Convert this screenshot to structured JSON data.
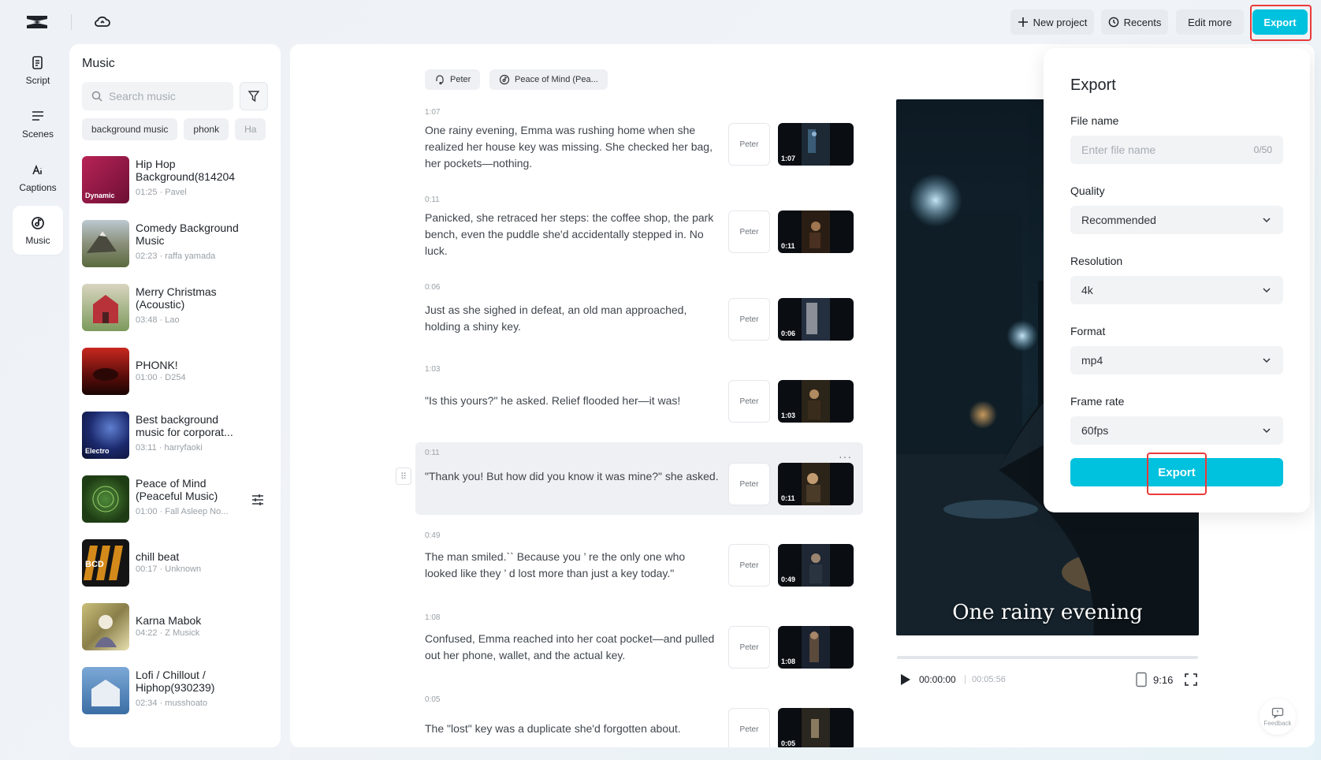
{
  "header": {
    "logo_icon": "capcut-logo-icon",
    "cloud_icon": "cloud-icon",
    "new_project_label": "New project",
    "recents_label": "Recents",
    "edit_more_label": "Edit more",
    "export_label": "Export"
  },
  "nav": [
    {
      "label": "Script",
      "icon": "script-icon"
    },
    {
      "label": "Scenes",
      "icon": "scenes-icon"
    },
    {
      "label": "Captions",
      "icon": "captions-icon"
    },
    {
      "label": "Music",
      "icon": "music-icon",
      "active": true
    }
  ],
  "music": {
    "title": "Music",
    "search_placeholder": "Search music",
    "chips": [
      "background music",
      "phonk",
      "Ha"
    ],
    "tracks": [
      {
        "title": "Hip Hop Background(814204",
        "meta": "01:25 · Pavel",
        "thumb_label": "Dynamic"
      },
      {
        "title": "Comedy Background Music",
        "meta": "02:23 · raffa yamada",
        "thumb_label": ""
      },
      {
        "title": "Merry Christmas (Acoustic)",
        "meta": "03:48 · Lao",
        "thumb_label": ""
      },
      {
        "title": "PHONK!",
        "meta": "01:00 · D254",
        "thumb_label": ""
      },
      {
        "title": "Best background music for corporat...",
        "meta": "03:11 · harryfaoki",
        "thumb_label": "Electro"
      },
      {
        "title": "Peace of Mind (Peaceful Music)",
        "meta": "01:00 · Fall Asleep No...",
        "thumb_label": ""
      },
      {
        "title": "chill beat",
        "meta": "00:17 · Unknown",
        "thumb_label": "BCD"
      },
      {
        "title": "Karna Mabok",
        "meta": "04:22 · Z Musick",
        "thumb_label": ""
      },
      {
        "title": "Lofi / Chillout / Hiphop(930239)",
        "meta": "02:34 · musshoato",
        "thumb_label": ""
      }
    ]
  },
  "script": {
    "tags": [
      {
        "label": "Peter",
        "icon": "voice-icon"
      },
      {
        "label": "Peace of Mind (Pea...",
        "icon": "music-note-icon"
      }
    ],
    "rows": [
      {
        "time": "1:07",
        "text": "One rainy evening, Emma was rushing home when she realized her house key was missing. She checked her bag, her pockets—nothing.",
        "voice": "Peter",
        "clip": "1:07"
      },
      {
        "time": "0:11",
        "text": "Panicked, she retraced her steps: the coffee shop, the park bench, even the puddle she'd accidentally stepped in. No luck.",
        "voice": "Peter",
        "clip": "0:11"
      },
      {
        "time": "0:06",
        "text": "Just as she sighed in defeat, an old man approached, holding a shiny key.",
        "voice": "Peter",
        "clip": "0:06"
      },
      {
        "time": "1:03",
        "text": "\"Is this yours?\" he asked. Relief flooded her—it was!",
        "voice": "Peter",
        "clip": "1:03"
      },
      {
        "time": "0:11",
        "text": "\"Thank you! But how did you know it was mine?\" she asked.",
        "voice": "Peter",
        "clip": "0:11"
      },
      {
        "time": "0:49",
        "text": "The man smiled.`` Because you ’ re the only one who looked like they ’ d lost more than just a key today.\"",
        "voice": "Peter",
        "clip": "0:49"
      },
      {
        "time": "1:08",
        "text": "Confused, Emma reached into her coat pocket—and pulled out her phone, wallet, and the actual key.",
        "voice": "Peter",
        "clip": "1:08"
      },
      {
        "time": "0:05",
        "text": "The \"lost\" key was a duplicate she'd forgotten about.",
        "voice": "Peter",
        "clip": "0:05"
      }
    ]
  },
  "preview": {
    "caption": "One rainy evening",
    "current_time": "00:00:00",
    "separator": "|",
    "total_time": "00:05:56",
    "ratio": "9:16",
    "progress": 0
  },
  "export_dialog": {
    "title": "Export",
    "file_name_label": "File name",
    "file_name_placeholder": "Enter file name",
    "file_name_counter": "0/50",
    "quality_label": "Quality",
    "quality_value": "Recommended",
    "resolution_label": "Resolution",
    "resolution_value": "4k",
    "format_label": "Format",
    "format_value": "mp4",
    "frame_rate_label": "Frame rate",
    "frame_rate_value": "60fps",
    "export_label": "Export"
  },
  "feedback_label": "Feedback",
  "colors": {
    "accent": "#00c1de",
    "highlight": "#ea3b3b"
  }
}
